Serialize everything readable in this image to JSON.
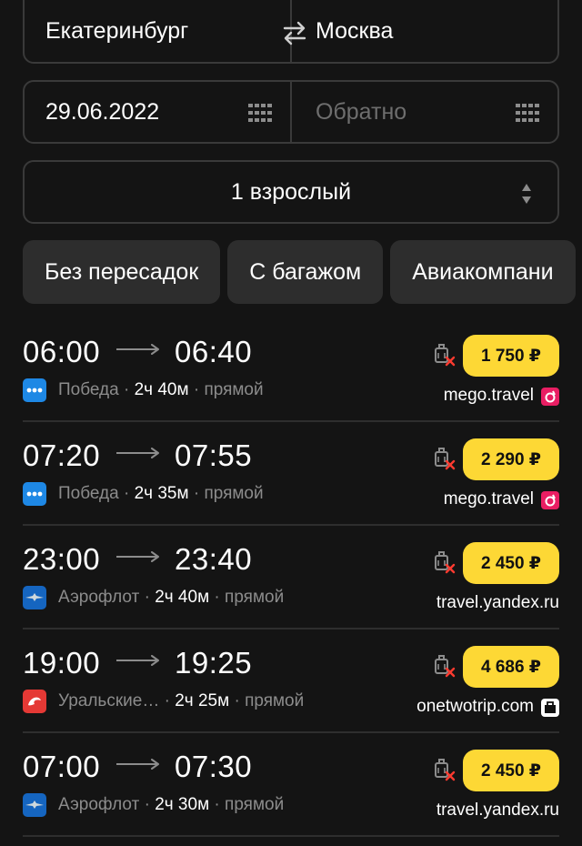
{
  "search": {
    "from": "Екатеринбург",
    "to": "Москва",
    "depart_date": "29.06.2022",
    "return_placeholder": "Обратно",
    "passengers": "1 взрослый"
  },
  "filters": [
    "Без пересадок",
    "С багажом",
    "Авиакомпани"
  ],
  "colors": {
    "accent_price": "#fdd835",
    "background": "#141414",
    "pobeda": "#1e88e5",
    "aeroflot": "#1565c0",
    "ural": "#e53935",
    "mego": "#e91e63",
    "baggage_cross": "#ff3b30"
  },
  "flights": [
    {
      "dep": "06:00",
      "arr": "06:40",
      "airline": "Победа",
      "airline_icon": "pobeda-logo",
      "duration": "2ч 40м",
      "type": "прямой",
      "price": "1 750 ₽",
      "agency": "mego.travel",
      "agency_icon": "mego-icon"
    },
    {
      "dep": "07:20",
      "arr": "07:55",
      "airline": "Победа",
      "airline_icon": "pobeda-logo",
      "duration": "2ч 35м",
      "type": "прямой",
      "price": "2 290 ₽",
      "agency": "mego.travel",
      "agency_icon": "mego-icon"
    },
    {
      "dep": "23:00",
      "arr": "23:40",
      "airline": "Аэрофлот",
      "airline_icon": "aeroflot-logo",
      "duration": "2ч 40м",
      "type": "прямой",
      "price": "2 450 ₽",
      "agency": "travel.yandex.ru",
      "agency_icon": "yandex-bag-icon"
    },
    {
      "dep": "19:00",
      "arr": "19:25",
      "airline": "Уральские…",
      "airline_icon": "ural-logo",
      "duration": "2ч 25м",
      "type": "прямой",
      "price": "4 686 ₽",
      "agency": "onetwotrip.com",
      "agency_icon": "onetwotrip-bag-icon"
    },
    {
      "dep": "07:00",
      "arr": "07:30",
      "airline": "Аэрофлот",
      "airline_icon": "aeroflot-logo",
      "duration": "2ч 30м",
      "type": "прямой",
      "price": "2 450 ₽",
      "agency": "travel.yandex.ru",
      "agency_icon": "yandex-bag-icon"
    }
  ]
}
